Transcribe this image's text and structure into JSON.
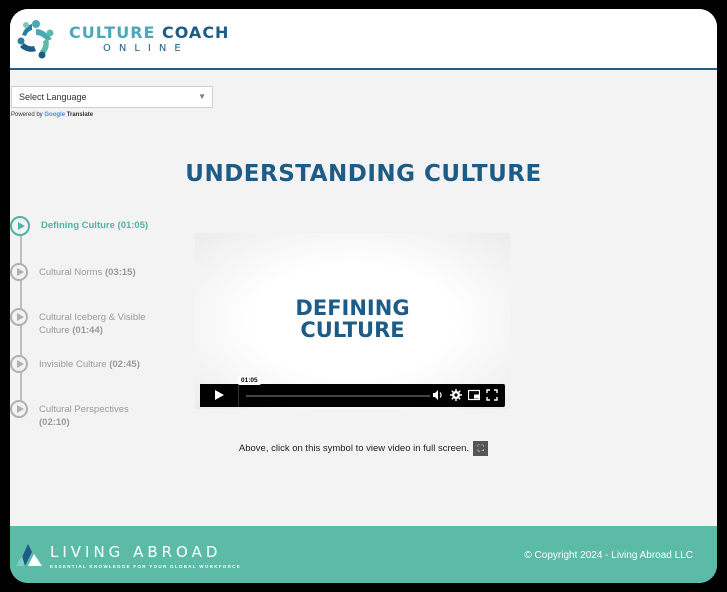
{
  "brand": {
    "name_part1": "CULTURE ",
    "name_part2": "COACH",
    "name_line2": "ONLINE",
    "logo_icon": "people-circle-logo-icon"
  },
  "language": {
    "selected": "Select Language",
    "powered_prefix": "Powered by",
    "powered_google": "Google",
    "powered_suffix": "Translate"
  },
  "page_title": "UNDERSTANDING CULTURE",
  "lessons": [
    {
      "title": "Defining Culture",
      "duration": "(01:05)",
      "active": true
    },
    {
      "title": "Cultural Norms",
      "duration": "(03:15)",
      "active": false
    },
    {
      "title": "Cultural Iceberg & Visible Culture",
      "duration": "(01:44)",
      "active": false
    },
    {
      "title": "Invisible Culture",
      "duration": "(02:45)",
      "active": false
    },
    {
      "title": "Cultural Perspectives",
      "duration": "(02:10)",
      "active": false
    }
  ],
  "video": {
    "title_line1": "DEFINING",
    "title_line2": "CULTURE",
    "time": "01:05",
    "progress": 0
  },
  "fullscreen_note": "Above, click on this symbol to view video in full screen.",
  "footer": {
    "brand": "LIVING ABROAD",
    "tagline": "ESSENTIAL KNOWLEDGE FOR YOUR GLOBAL WORKFORCE",
    "copyright": "© Copyright 2024 - Living Abroad LLC"
  },
  "colors": {
    "primary": "#1d5c86",
    "accent": "#4fb3a3",
    "footer": "#5bbba7"
  }
}
